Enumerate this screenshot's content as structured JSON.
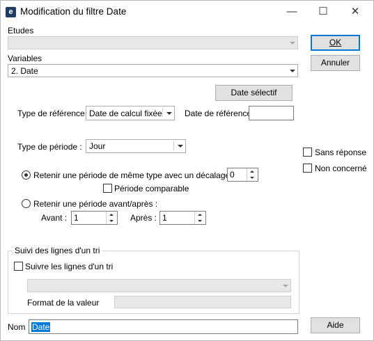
{
  "window": {
    "app_icon": "app-logo-icon",
    "title": "Modification du filtre Date",
    "controls": {
      "minimize": "—",
      "maximize": "☐",
      "close": "✕"
    }
  },
  "etudes": {
    "label": "Etudes",
    "value": ""
  },
  "variables": {
    "label": "Variables",
    "value": "2. Date"
  },
  "buttons": {
    "ok": "OK",
    "annuler": "Annuler",
    "date_selectif": "Date sélectif",
    "aide": "Aide"
  },
  "reference": {
    "type_label": "Type de référence :",
    "type_value": "Date de calcul fixée",
    "date_label": "Date de référence",
    "date_value": ""
  },
  "periode": {
    "type_label": "Type de période :",
    "type_value": "Jour"
  },
  "right_checks": {
    "sans_reponse": "Sans réponse",
    "non_concerne": "Non concerné"
  },
  "option_decalage": {
    "label": "Retenir une période de même type avec un décalage de :",
    "value": "0",
    "selected": true,
    "comparable_label": "Période comparable"
  },
  "option_avant_apres": {
    "label": "Retenir une période avant/après :",
    "selected": false,
    "avant_label": "Avant :",
    "avant_value": "1",
    "apres_label": "Après :",
    "apres_value": "1"
  },
  "suivi": {
    "group_title": "Suivi des lignes d'un tri",
    "checkbox_label": "Suivre les lignes d'un tri",
    "tri_value": "",
    "format_label": "Format de la valeur",
    "format_value": ""
  },
  "nom": {
    "label": "Nom",
    "value": "Date"
  }
}
